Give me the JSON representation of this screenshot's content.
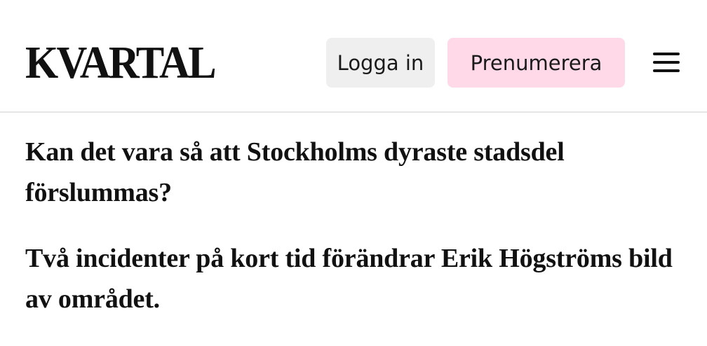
{
  "header": {
    "logo": "KVARTAL",
    "login_label": "Logga in",
    "subscribe_label": "Prenumerera",
    "menu_icon": "hamburger-menu-icon"
  },
  "colors": {
    "login_bg": "#efefef",
    "subscribe_bg": "#ffd9e8",
    "divider": "#e6e6e6",
    "text": "#111111"
  },
  "article": {
    "headline": "Kan det vara så att Stockholms dyraste stadsdel förslummas?",
    "subheadline": "Två incidenter på kort tid förändrar Erik Högströms bild av området."
  }
}
